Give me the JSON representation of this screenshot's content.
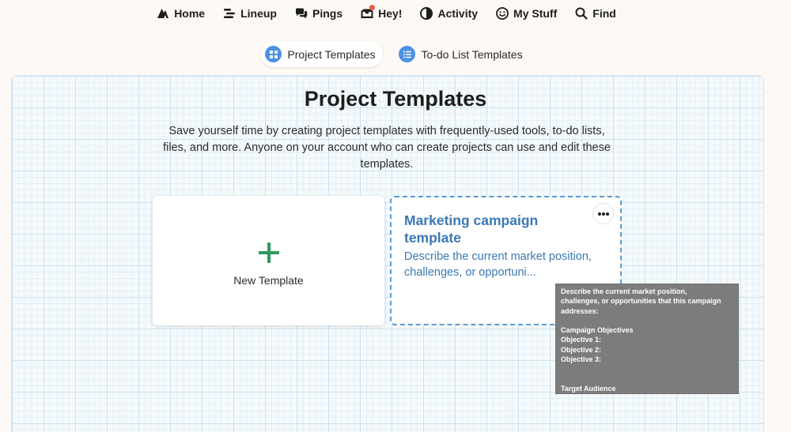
{
  "nav": {
    "items": [
      {
        "label": "Home",
        "icon": "home-icon"
      },
      {
        "label": "Lineup",
        "icon": "lineup-icon"
      },
      {
        "label": "Pings",
        "icon": "pings-icon"
      },
      {
        "label": "Hey!",
        "icon": "hey-inbox-icon"
      },
      {
        "label": "Activity",
        "icon": "activity-icon"
      },
      {
        "label": "My Stuff",
        "icon": "smiley-icon"
      },
      {
        "label": "Find",
        "icon": "search-icon"
      }
    ]
  },
  "tabs": [
    {
      "label": "Project Templates",
      "icon": "grid-icon",
      "active": true
    },
    {
      "label": "To-do List Templates",
      "icon": "list-icon",
      "active": false
    }
  ],
  "page": {
    "title": "Project Templates",
    "description": "Save yourself time by creating project templates with frequently-used tools, to-do lists, files, and more. Anyone on your account who can create projects can use and edit these templates."
  },
  "new_card": {
    "label": "New Template"
  },
  "template_card": {
    "title": "Marketing campaign template",
    "description": "Describe the current market position, challenges, or opportuni..."
  },
  "tooltip": {
    "lines": [
      "Describe the current market position,",
      "challenges, or opportunities that this campaign",
      "addresses:",
      "",
      "Campaign Objectives",
      "Objective 1:",
      "Objective 2:",
      "Objective 3:",
      "",
      "",
      "Target Audience"
    ]
  },
  "colors": {
    "accent_blue": "#3a78b5",
    "tab_icon_blue": "#4d90e6",
    "plus_green": "#2e9a5e",
    "notification": "#e8603c"
  }
}
